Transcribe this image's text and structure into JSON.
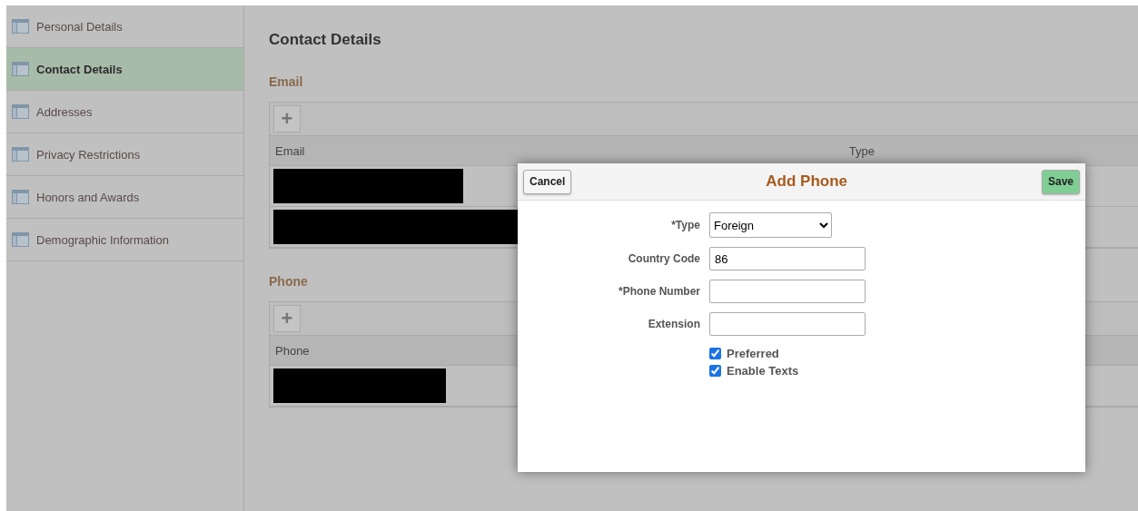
{
  "sidebar": {
    "items": [
      {
        "label": "Personal Details",
        "selected": false
      },
      {
        "label": "Contact Details",
        "selected": true
      },
      {
        "label": "Addresses",
        "selected": false
      },
      {
        "label": "Privacy Restrictions",
        "selected": false
      },
      {
        "label": "Honors and Awards",
        "selected": false
      },
      {
        "label": "Demographic Information",
        "selected": false
      }
    ]
  },
  "page_title": "Contact Details",
  "sections": [
    {
      "title": "Email",
      "add_button": "+",
      "columns": [
        "Email",
        "Type"
      ],
      "rows": [
        {
          "kind": "redacted",
          "level": 0.22
        },
        {
          "kind": "redacted",
          "level": 0.35
        }
      ]
    },
    {
      "title": "Phone",
      "add_button": "+",
      "columns": [
        "Phone"
      ],
      "rows": [
        {
          "kind": "redacted",
          "level": 0.2
        }
      ]
    }
  ],
  "dialog": {
    "title": "Add Phone",
    "cancel": "Cancel",
    "save": "Save",
    "fields": [
      {
        "kind": "select",
        "label": "*Type",
        "value": "Foreign"
      },
      {
        "kind": "input",
        "label": "Country Code",
        "value": "86"
      },
      {
        "kind": "input",
        "label": "*Phone Number"
      },
      {
        "kind": "input",
        "label": "Extension"
      }
    ],
    "checkboxes": [
      {
        "label": "Preferred",
        "checked": true
      },
      {
        "label": "Enable Texts",
        "checked": true
      }
    ]
  }
}
